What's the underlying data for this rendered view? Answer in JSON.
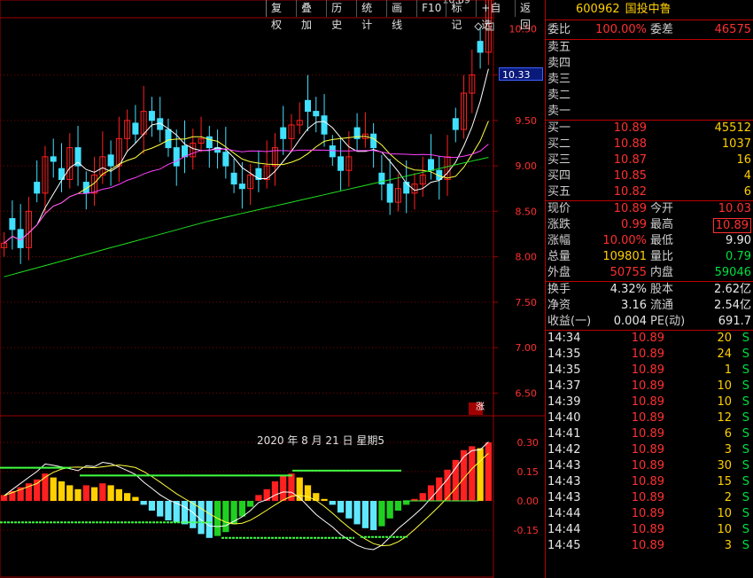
{
  "toolbar": {
    "items": [
      "复权",
      "叠加",
      "历史",
      "统计",
      "画线",
      "F10",
      "标记",
      "+自选",
      "返回"
    ]
  },
  "chart": {
    "max_label": "10.89",
    "current_price_tag": "10.33",
    "price_axis": [
      "10.00",
      "9.50",
      "9.00",
      "8.50",
      "8.00",
      "7.50",
      "7.00",
      "6.50"
    ],
    "partial_axis": "10.50",
    "indicator_axis": [
      "0.30",
      "0.15",
      "0.00",
      "-0.15"
    ],
    "date_label": "2020 年 8 月 21 日 星期5",
    "zhang_badge": "涨",
    "colors": {
      "up": "#ff2020",
      "down": "#40e0ff",
      "ma5": "#ffffff",
      "ma10": "#ffff40",
      "ma20": "#ff40ff",
      "ma60": "#20e020"
    }
  },
  "panel": {
    "code": "600962",
    "name": "国投中鲁",
    "weibi_label": "委比",
    "weibi_value": "100.00%",
    "weicha_label": "委差",
    "weicha_value": "46575",
    "sells": [
      "卖五",
      "卖四",
      "卖三",
      "卖二",
      "卖一"
    ],
    "buys": [
      {
        "label": "买一",
        "price": "10.89",
        "vol": "45512"
      },
      {
        "label": "买二",
        "price": "10.88",
        "vol": "1037"
      },
      {
        "label": "买三",
        "price": "10.87",
        "vol": "16"
      },
      {
        "label": "买四",
        "price": "10.85",
        "vol": "4"
      },
      {
        "label": "买五",
        "price": "10.82",
        "vol": "6"
      }
    ],
    "stats": [
      {
        "l1": "现价",
        "v1": "10.89",
        "l2": "今开",
        "v2": "10.03"
      },
      {
        "l1": "涨跌",
        "v1": "0.99",
        "l2": "最高",
        "v2": "10.89"
      },
      {
        "l1": "涨幅",
        "v1": "10.00%",
        "l2": "最低",
        "v2": "9.90"
      },
      {
        "l1": "总量",
        "v1": "109801",
        "l2": "量比",
        "v2": "0.79"
      },
      {
        "l1": "外盘",
        "v1": "50755",
        "l2": "内盘",
        "v2": "59046"
      }
    ],
    "fin": [
      {
        "l1": "换手",
        "v1": "4.32%",
        "l2": "股本",
        "v2": "2.62亿"
      },
      {
        "l1": "净资",
        "v1": "3.16",
        "l2": "流通",
        "v2": "2.54亿"
      },
      {
        "l1": "收益(一)",
        "v1": "0.004",
        "l2": "PE(动)",
        "v2": "691.7"
      }
    ],
    "ticks": [
      {
        "t": "14:34",
        "p": "10.89",
        "v": "20",
        "s": "S"
      },
      {
        "t": "14:35",
        "p": "10.89",
        "v": "24",
        "s": "S"
      },
      {
        "t": "14:35",
        "p": "10.89",
        "v": "1",
        "s": "S"
      },
      {
        "t": "14:37",
        "p": "10.89",
        "v": "10",
        "s": "S"
      },
      {
        "t": "14:39",
        "p": "10.89",
        "v": "10",
        "s": "S"
      },
      {
        "t": "14:40",
        "p": "10.89",
        "v": "12",
        "s": "S"
      },
      {
        "t": "14:41",
        "p": "10.89",
        "v": "6",
        "s": "S"
      },
      {
        "t": "14:42",
        "p": "10.89",
        "v": "3",
        "s": "S"
      },
      {
        "t": "14:43",
        "p": "10.89",
        "v": "30",
        "s": "S"
      },
      {
        "t": "14:43",
        "p": "10.89",
        "v": "15",
        "s": "S"
      },
      {
        "t": "14:43",
        "p": "10.89",
        "v": "2",
        "s": "S"
      },
      {
        "t": "14:44",
        "p": "10.89",
        "v": "10",
        "s": "S"
      },
      {
        "t": "14:44",
        "p": "10.89",
        "v": "10",
        "s": "S"
      },
      {
        "t": "14:45",
        "p": "10.89",
        "v": "3",
        "s": "S"
      }
    ]
  }
}
